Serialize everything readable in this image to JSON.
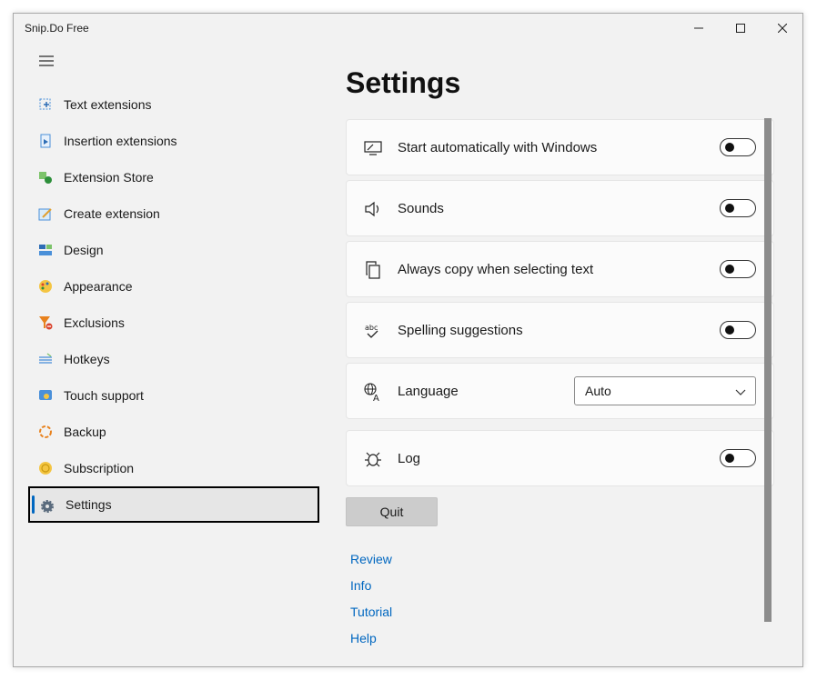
{
  "window": {
    "title": "Snip.Do Free"
  },
  "sidebar": {
    "items": [
      {
        "label": "Text extensions",
        "icon": "text-extensions-icon"
      },
      {
        "label": "Insertion extensions",
        "icon": "insertion-extensions-icon"
      },
      {
        "label": "Extension Store",
        "icon": "extension-store-icon"
      },
      {
        "label": "Create extension",
        "icon": "create-extension-icon"
      },
      {
        "label": "Design",
        "icon": "design-icon"
      },
      {
        "label": "Appearance",
        "icon": "appearance-icon"
      },
      {
        "label": "Exclusions",
        "icon": "exclusions-icon"
      },
      {
        "label": "Hotkeys",
        "icon": "hotkeys-icon"
      },
      {
        "label": "Touch support",
        "icon": "touch-support-icon"
      },
      {
        "label": "Backup",
        "icon": "backup-icon"
      },
      {
        "label": "Subscription",
        "icon": "subscription-icon"
      },
      {
        "label": "Settings",
        "icon": "gear-icon",
        "selected": true
      }
    ]
  },
  "main": {
    "title": "Settings",
    "settings": [
      {
        "label": "Start automatically with Windows",
        "control": "toggle",
        "on": false
      },
      {
        "label": "Sounds",
        "control": "toggle",
        "on": false
      },
      {
        "label": "Always copy when selecting text",
        "control": "toggle",
        "on": false
      },
      {
        "label": "Spelling suggestions",
        "control": "toggle",
        "on": false
      },
      {
        "label": "Language",
        "control": "select",
        "value": "Auto"
      },
      {
        "label": "Log",
        "control": "toggle",
        "on": false
      }
    ],
    "quit_label": "Quit",
    "links": [
      "Review",
      "Info",
      "Tutorial",
      "Help"
    ]
  },
  "colors": {
    "accent": "#0067c0",
    "background": "#f2f2f2",
    "card": "#fbfbfb"
  }
}
